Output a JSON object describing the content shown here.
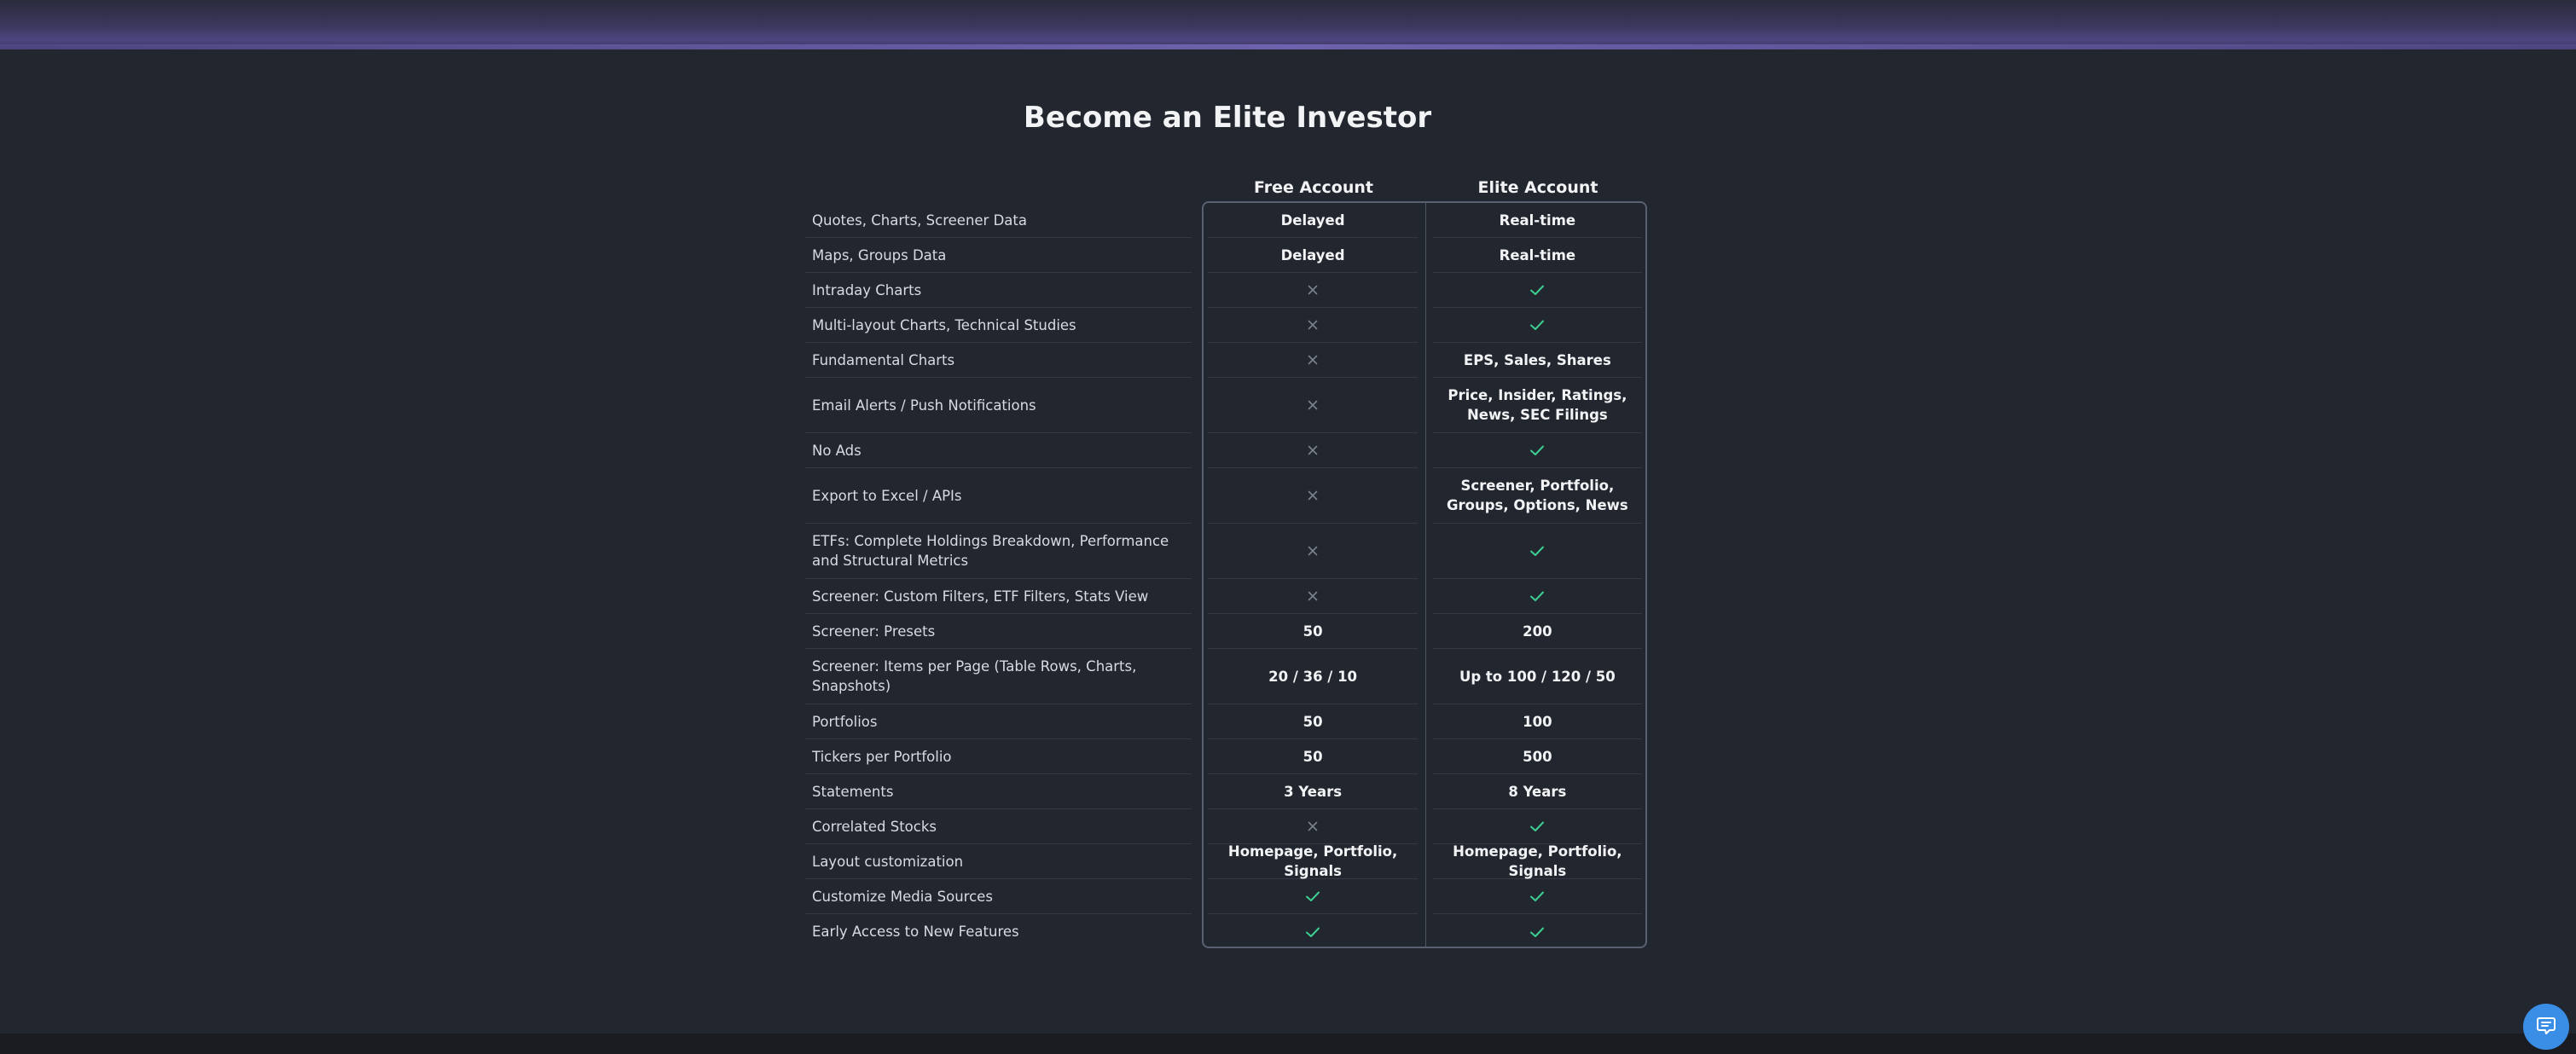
{
  "page": {
    "title": "Become an Elite Investor"
  },
  "columns": {
    "free": "Free Account",
    "elite": "Elite Account"
  },
  "colors": {
    "check": "#3ccf91",
    "cross": "#7b818d",
    "background": "#22262f",
    "chat_button": "#3b8ee6"
  },
  "rows": [
    {
      "feature": "Quotes, Charts, Screener Data",
      "free": {
        "type": "text",
        "text": "Delayed"
      },
      "elite": {
        "type": "text",
        "text": "Real-time"
      }
    },
    {
      "feature": "Maps, Groups Data",
      "free": {
        "type": "text",
        "text": "Delayed"
      },
      "elite": {
        "type": "text",
        "text": "Real-time"
      }
    },
    {
      "feature": "Intraday Charts",
      "free": {
        "type": "cross"
      },
      "elite": {
        "type": "check"
      }
    },
    {
      "feature": "Multi-layout Charts, Technical Studies",
      "free": {
        "type": "cross"
      },
      "elite": {
        "type": "check"
      }
    },
    {
      "feature": "Fundamental Charts",
      "free": {
        "type": "cross"
      },
      "elite": {
        "type": "text",
        "text": "EPS, Sales, Shares"
      }
    },
    {
      "feature": "Email Alerts / Push Notifications",
      "free": {
        "type": "cross"
      },
      "elite": {
        "type": "text",
        "text": "Price, Insider, Ratings, News, SEC Filings"
      }
    },
    {
      "feature": "No Ads",
      "free": {
        "type": "cross"
      },
      "elite": {
        "type": "check"
      }
    },
    {
      "feature": "Export to Excel / APIs",
      "free": {
        "type": "cross"
      },
      "elite": {
        "type": "text",
        "text": "Screener, Portfolio, Groups, Options, News"
      }
    },
    {
      "feature": "ETFs: Complete Holdings Breakdown, Performance and Structural Metrics",
      "free": {
        "type": "cross"
      },
      "elite": {
        "type": "check"
      }
    },
    {
      "feature": "Screener: Custom Filters, ETF Filters, Stats View",
      "free": {
        "type": "cross"
      },
      "elite": {
        "type": "check"
      }
    },
    {
      "feature": "Screener: Presets",
      "free": {
        "type": "text",
        "text": "50"
      },
      "elite": {
        "type": "text",
        "text": "200"
      }
    },
    {
      "feature": "Screener: Items per Page (Table Rows, Charts, Snapshots)",
      "free": {
        "type": "text",
        "text": "20 / 36 / 10"
      },
      "elite": {
        "type": "text",
        "text": "Up to 100 / 120 / 50"
      }
    },
    {
      "feature": "Portfolios",
      "free": {
        "type": "text",
        "text": "50"
      },
      "elite": {
        "type": "text",
        "text": "100"
      }
    },
    {
      "feature": "Tickers per Portfolio",
      "free": {
        "type": "text",
        "text": "50"
      },
      "elite": {
        "type": "text",
        "text": "500"
      }
    },
    {
      "feature": "Statements",
      "free": {
        "type": "text",
        "text": "3 Years"
      },
      "elite": {
        "type": "text",
        "text": "8 Years"
      }
    },
    {
      "feature": "Correlated Stocks",
      "free": {
        "type": "cross"
      },
      "elite": {
        "type": "check"
      }
    },
    {
      "feature": "Layout customization",
      "free": {
        "type": "text",
        "text": "Homepage, Portfolio, Signals"
      },
      "elite": {
        "type": "text",
        "text": "Homepage, Portfolio, Signals"
      }
    },
    {
      "feature": "Customize Media Sources",
      "free": {
        "type": "check"
      },
      "elite": {
        "type": "check"
      }
    },
    {
      "feature": "Early Access to New Features",
      "free": {
        "type": "check"
      },
      "elite": {
        "type": "check"
      }
    }
  ],
  "chat": {
    "icon": "chat-bubble-icon"
  }
}
